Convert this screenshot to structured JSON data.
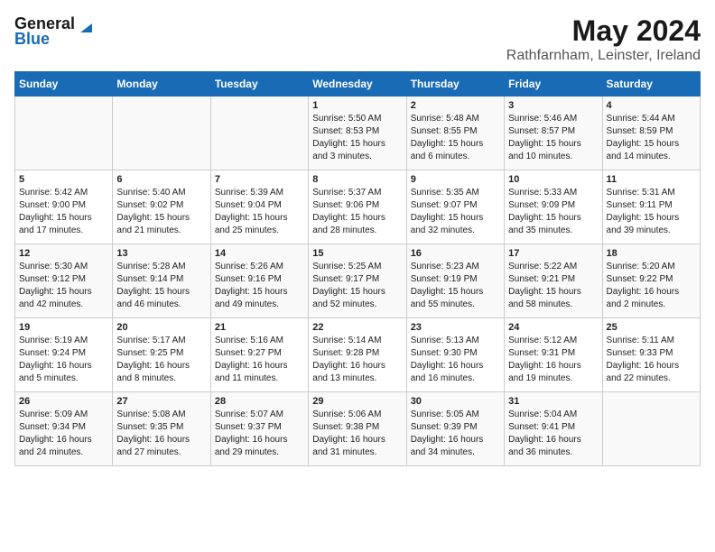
{
  "logo": {
    "general": "General",
    "blue": "Blue"
  },
  "title": "May 2024",
  "subtitle": "Rathfarnham, Leinster, Ireland",
  "days": [
    "Sunday",
    "Monday",
    "Tuesday",
    "Wednesday",
    "Thursday",
    "Friday",
    "Saturday"
  ],
  "weeks": [
    [
      {
        "num": "",
        "text": ""
      },
      {
        "num": "",
        "text": ""
      },
      {
        "num": "",
        "text": ""
      },
      {
        "num": "1",
        "text": "Sunrise: 5:50 AM\nSunset: 8:53 PM\nDaylight: 15 hours and 3 minutes."
      },
      {
        "num": "2",
        "text": "Sunrise: 5:48 AM\nSunset: 8:55 PM\nDaylight: 15 hours and 6 minutes."
      },
      {
        "num": "3",
        "text": "Sunrise: 5:46 AM\nSunset: 8:57 PM\nDaylight: 15 hours and 10 minutes."
      },
      {
        "num": "4",
        "text": "Sunrise: 5:44 AM\nSunset: 8:59 PM\nDaylight: 15 hours and 14 minutes."
      }
    ],
    [
      {
        "num": "5",
        "text": "Sunrise: 5:42 AM\nSunset: 9:00 PM\nDaylight: 15 hours and 17 minutes."
      },
      {
        "num": "6",
        "text": "Sunrise: 5:40 AM\nSunset: 9:02 PM\nDaylight: 15 hours and 21 minutes."
      },
      {
        "num": "7",
        "text": "Sunrise: 5:39 AM\nSunset: 9:04 PM\nDaylight: 15 hours and 25 minutes."
      },
      {
        "num": "8",
        "text": "Sunrise: 5:37 AM\nSunset: 9:06 PM\nDaylight: 15 hours and 28 minutes."
      },
      {
        "num": "9",
        "text": "Sunrise: 5:35 AM\nSunset: 9:07 PM\nDaylight: 15 hours and 32 minutes."
      },
      {
        "num": "10",
        "text": "Sunrise: 5:33 AM\nSunset: 9:09 PM\nDaylight: 15 hours and 35 minutes."
      },
      {
        "num": "11",
        "text": "Sunrise: 5:31 AM\nSunset: 9:11 PM\nDaylight: 15 hours and 39 minutes."
      }
    ],
    [
      {
        "num": "12",
        "text": "Sunrise: 5:30 AM\nSunset: 9:12 PM\nDaylight: 15 hours and 42 minutes."
      },
      {
        "num": "13",
        "text": "Sunrise: 5:28 AM\nSunset: 9:14 PM\nDaylight: 15 hours and 46 minutes."
      },
      {
        "num": "14",
        "text": "Sunrise: 5:26 AM\nSunset: 9:16 PM\nDaylight: 15 hours and 49 minutes."
      },
      {
        "num": "15",
        "text": "Sunrise: 5:25 AM\nSunset: 9:17 PM\nDaylight: 15 hours and 52 minutes."
      },
      {
        "num": "16",
        "text": "Sunrise: 5:23 AM\nSunset: 9:19 PM\nDaylight: 15 hours and 55 minutes."
      },
      {
        "num": "17",
        "text": "Sunrise: 5:22 AM\nSunset: 9:21 PM\nDaylight: 15 hours and 58 minutes."
      },
      {
        "num": "18",
        "text": "Sunrise: 5:20 AM\nSunset: 9:22 PM\nDaylight: 16 hours and 2 minutes."
      }
    ],
    [
      {
        "num": "19",
        "text": "Sunrise: 5:19 AM\nSunset: 9:24 PM\nDaylight: 16 hours and 5 minutes."
      },
      {
        "num": "20",
        "text": "Sunrise: 5:17 AM\nSunset: 9:25 PM\nDaylight: 16 hours and 8 minutes."
      },
      {
        "num": "21",
        "text": "Sunrise: 5:16 AM\nSunset: 9:27 PM\nDaylight: 16 hours and 11 minutes."
      },
      {
        "num": "22",
        "text": "Sunrise: 5:14 AM\nSunset: 9:28 PM\nDaylight: 16 hours and 13 minutes."
      },
      {
        "num": "23",
        "text": "Sunrise: 5:13 AM\nSunset: 9:30 PM\nDaylight: 16 hours and 16 minutes."
      },
      {
        "num": "24",
        "text": "Sunrise: 5:12 AM\nSunset: 9:31 PM\nDaylight: 16 hours and 19 minutes."
      },
      {
        "num": "25",
        "text": "Sunrise: 5:11 AM\nSunset: 9:33 PM\nDaylight: 16 hours and 22 minutes."
      }
    ],
    [
      {
        "num": "26",
        "text": "Sunrise: 5:09 AM\nSunset: 9:34 PM\nDaylight: 16 hours and 24 minutes."
      },
      {
        "num": "27",
        "text": "Sunrise: 5:08 AM\nSunset: 9:35 PM\nDaylight: 16 hours and 27 minutes."
      },
      {
        "num": "28",
        "text": "Sunrise: 5:07 AM\nSunset: 9:37 PM\nDaylight: 16 hours and 29 minutes."
      },
      {
        "num": "29",
        "text": "Sunrise: 5:06 AM\nSunset: 9:38 PM\nDaylight: 16 hours and 31 minutes."
      },
      {
        "num": "30",
        "text": "Sunrise: 5:05 AM\nSunset: 9:39 PM\nDaylight: 16 hours and 34 minutes."
      },
      {
        "num": "31",
        "text": "Sunrise: 5:04 AM\nSunset: 9:41 PM\nDaylight: 16 hours and 36 minutes."
      },
      {
        "num": "",
        "text": ""
      }
    ]
  ]
}
